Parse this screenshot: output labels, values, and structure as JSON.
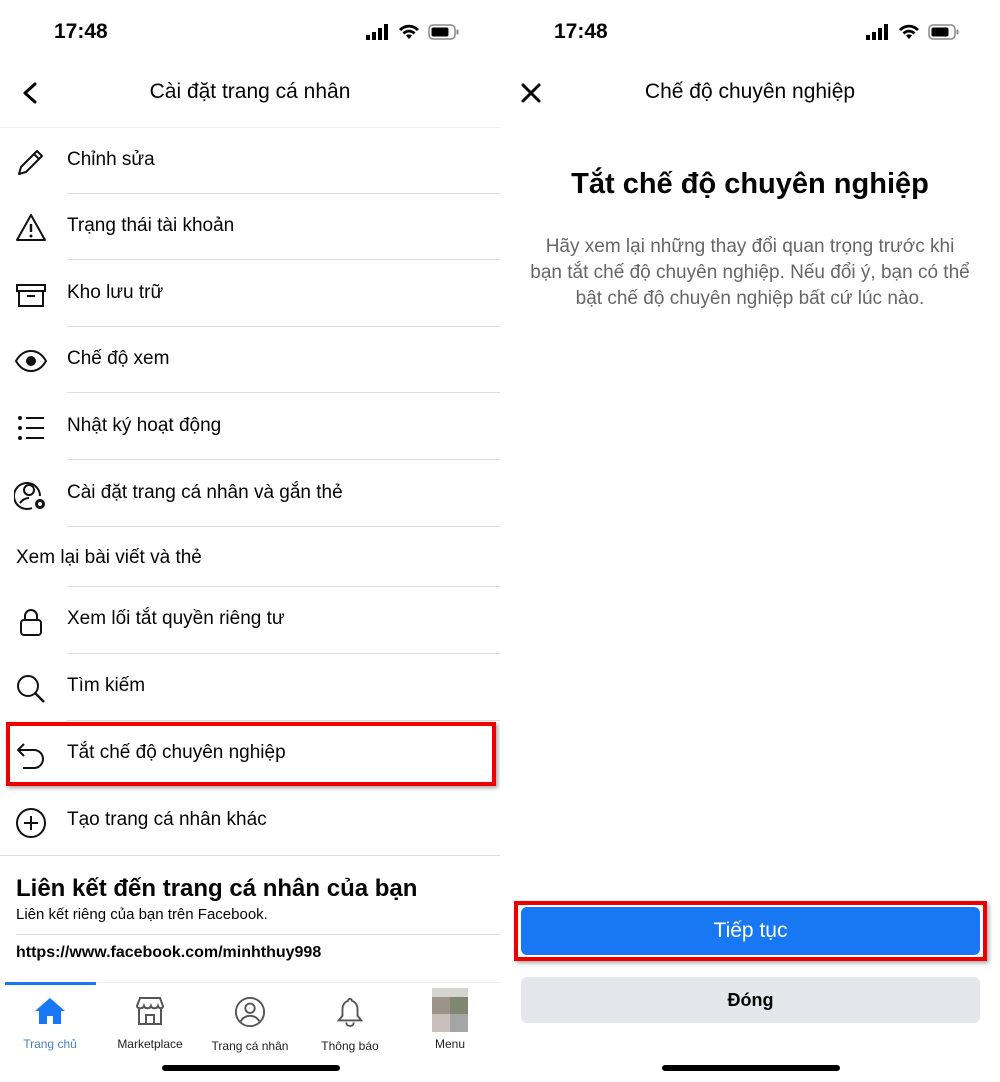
{
  "status": {
    "time": "17:48"
  },
  "left": {
    "title": "Cài đặt trang cá nhân",
    "items": [
      {
        "label": "Chỉnh sửa",
        "icon": "pencil-icon"
      },
      {
        "label": "Trạng thái tài khoản",
        "icon": "warning-icon"
      },
      {
        "label": "Kho lưu trữ",
        "icon": "archive-icon"
      },
      {
        "label": "Chế độ xem",
        "icon": "eye-icon"
      },
      {
        "label": "Nhật ký hoạt động",
        "icon": "list-icon"
      },
      {
        "label": "Cài đặt trang cá nhân và gắn thẻ",
        "icon": "profile-gear-icon"
      },
      {
        "label": "Xem lại bài viết và thẻ",
        "icon": ""
      },
      {
        "label": "Xem lối tắt quyền riêng tư",
        "icon": "lock-icon"
      },
      {
        "label": "Tìm kiếm",
        "icon": "search-icon"
      },
      {
        "label": "Tắt chế độ chuyên nghiệp",
        "icon": "undo-icon"
      },
      {
        "label": "Tạo trang cá nhân khác",
        "icon": "plus-circle-icon"
      }
    ],
    "link_section": {
      "title": "Liên kết đến trang cá nhân của bạn",
      "subtitle": "Liên kết riêng của bạn trên Facebook.",
      "url": "https://www.facebook.com/minhthuy998"
    },
    "nav": [
      {
        "label": "Trang chủ",
        "icon": "home-icon",
        "active": true
      },
      {
        "label": "Marketplace",
        "icon": "marketplace-icon"
      },
      {
        "label": "Trang cá nhân",
        "icon": "profile-icon"
      },
      {
        "label": "Thông báo",
        "icon": "bell-icon"
      },
      {
        "label": "Menu",
        "icon": "avatar-thumbnail"
      }
    ]
  },
  "right": {
    "title": "Chế độ chuyên nghiệp",
    "heading": "Tắt chế độ chuyên nghiệp",
    "body": "Hãy xem lại những thay đổi quan trọng trước khi bạn tắt chế độ chuyên nghiệp. Nếu đổi ý, bạn có thể bật chế độ chuyên nghiệp bất cứ lúc nào.",
    "continue_label": "Tiếp tục",
    "close_label": "Đóng"
  },
  "colors": {
    "accent": "#1877f2",
    "highlight": "#e00000",
    "secondary_button": "#e4e6eb"
  }
}
